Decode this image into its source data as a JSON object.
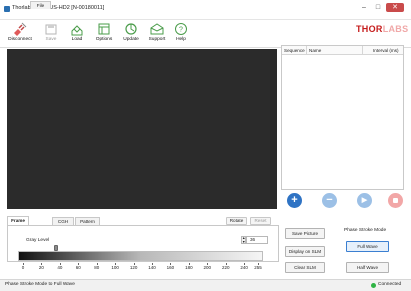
{
  "window": {
    "title": "Thorlabs EXULUS-HD2 [N-00180011]",
    "close_glyph": "✕",
    "min_glyph": "–",
    "max_glyph": "□"
  },
  "toolbar": {
    "items": [
      {
        "label": "Disconnect",
        "icon": "plug-icon",
        "enabled": true
      },
      {
        "label": "Save",
        "icon": "save-icon",
        "enabled": false
      },
      {
        "label": "Load",
        "icon": "load-icon",
        "enabled": true
      },
      {
        "label": "Options",
        "icon": "options-icon",
        "enabled": true
      },
      {
        "label": "Update",
        "icon": "update-icon",
        "enabled": true
      },
      {
        "label": "Support",
        "icon": "support-icon",
        "enabled": true
      },
      {
        "label": "Help",
        "icon": "help-icon",
        "enabled": true
      }
    ],
    "logo_a": "THOR",
    "logo_b": "LABS"
  },
  "sequence": {
    "col_sequence": "Sequence",
    "col_name": "Name",
    "col_interval": "Interval (ms)"
  },
  "controls": {
    "add": "+",
    "remove": "−",
    "play": "▶"
  },
  "tabs": [
    {
      "label": "Frame",
      "active": true
    },
    {
      "label": "File",
      "active": false
    },
    {
      "label": "CGH",
      "active": false
    },
    {
      "label": "Pattern",
      "active": false
    }
  ],
  "tab_buttons": {
    "rotate": "Rotate",
    "reset": "Reset"
  },
  "frame": {
    "gray_label": "Gray Level",
    "gray_value": "36",
    "gray_level_max": 255,
    "spin_up": "▲",
    "spin_down": "▼",
    "ticks": [
      "0",
      "20",
      "40",
      "60",
      "80",
      "100",
      "120",
      "140",
      "160",
      "180",
      "200",
      "220",
      "240",
      "255"
    ]
  },
  "actions": {
    "save_picture": "Save Picture",
    "display_slm": "Display on SLM",
    "clear_slm": "Clear SLM"
  },
  "mode": {
    "title": "Phase Stroke Mode",
    "full_wave": "Full Wave",
    "half_wave": "Half Wave"
  },
  "status": {
    "text": "Phase Stroke Mode to Full Wave",
    "connection": "Connected"
  },
  "colors": {
    "accent": "#2f73c4",
    "logo_red": "#c51a1a",
    "connected": "#2fb344"
  }
}
